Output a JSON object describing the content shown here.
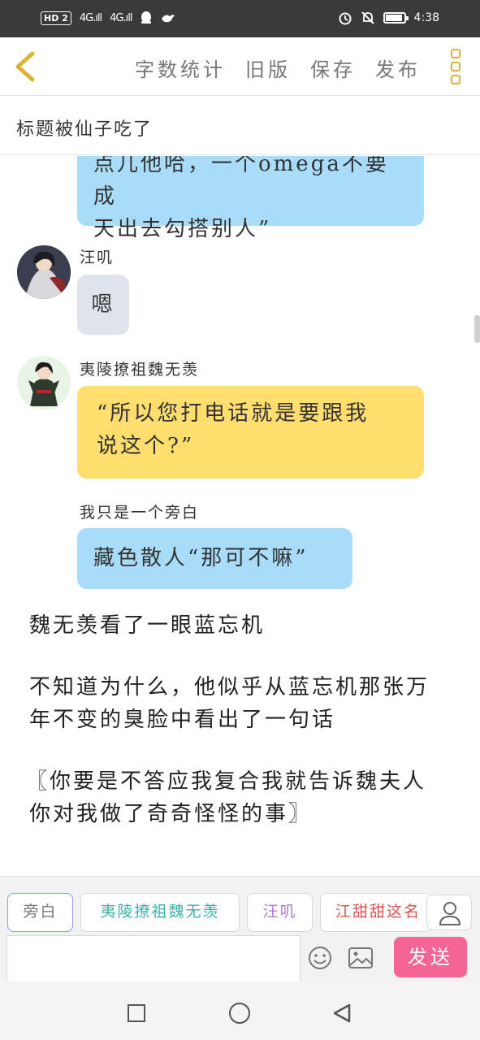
{
  "statusbar": {
    "badge": "HD 2",
    "sig1": "4G.ıll",
    "sig2": "4G.ıll",
    "time": "4:38"
  },
  "toolbar": {
    "word_count": "字数统计",
    "old_version": "旧版",
    "save": "保存",
    "publish": "发布"
  },
  "doc": {
    "title": "标题被仙子吃了"
  },
  "messages": [
    {
      "speaker": "",
      "text_line1": "点儿他哈，一个omega不要成",
      "text_line2": "天出去勾搭别人”",
      "color": "#a8dcf8"
    },
    {
      "speaker": "汪叽",
      "text": "嗯",
      "color": "#dfe4ec"
    },
    {
      "speaker": "夷陵撩祖魏无羡",
      "text_line1": "“所以您打电话就是要跟我",
      "text_line2": "说这个?”",
      "color": "#ffdd6e"
    },
    {
      "speaker": "我只是一个旁白",
      "text": "藏色散人“那可不嘛”",
      "color": "#a8dcf8"
    }
  ],
  "narration": [
    "魏无羡看了一眼蓝忘机",
    "不知道为什么，他似乎从蓝忘机那张万",
    "年不变的臭脸中看出了一句话",
    "〖你要是不答应我复合我就告诉魏夫人",
    "你对我做了奇奇怪怪的事〗",
    "……"
  ],
  "roles": [
    {
      "label": "旁白",
      "color": "#777777"
    },
    {
      "label": "夷陵撩祖魏无羡",
      "color": "#3bb3a8"
    },
    {
      "label": "汪叽",
      "color": "#b07ad8"
    },
    {
      "label": "江甜甜这名",
      "color": "#d9534f"
    }
  ],
  "composer": {
    "send_label": "发送"
  }
}
